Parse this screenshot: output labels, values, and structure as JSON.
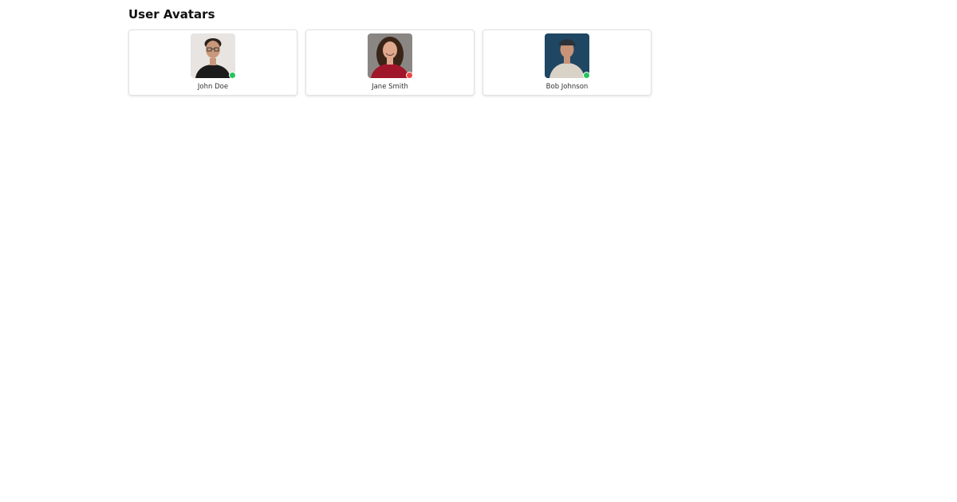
{
  "header": {
    "title": "User Avatars"
  },
  "users": [
    {
      "name": "John Doe",
      "status_color": "#22c55e",
      "photo": {
        "background": "#e7e4e1",
        "skin": "#c9987a",
        "hair": "#2b221c",
        "shirt": "#1b1b1b",
        "accent": "#3a3a3a"
      }
    },
    {
      "name": "Jane Smith",
      "status_color": "#ef4444",
      "photo": {
        "background": "#8a8683",
        "skin": "#e0a98e",
        "hair": "#3a2418",
        "shirt": "#a0162b",
        "accent": "#6f4f45"
      }
    },
    {
      "name": "Bob Johnson",
      "status_color": "#22c55e",
      "photo": {
        "background": "#1f4663",
        "skin": "#c89378",
        "hair": "#2c3238",
        "shirt": "#d9d3c7",
        "accent": "#3a4a55"
      }
    }
  ]
}
